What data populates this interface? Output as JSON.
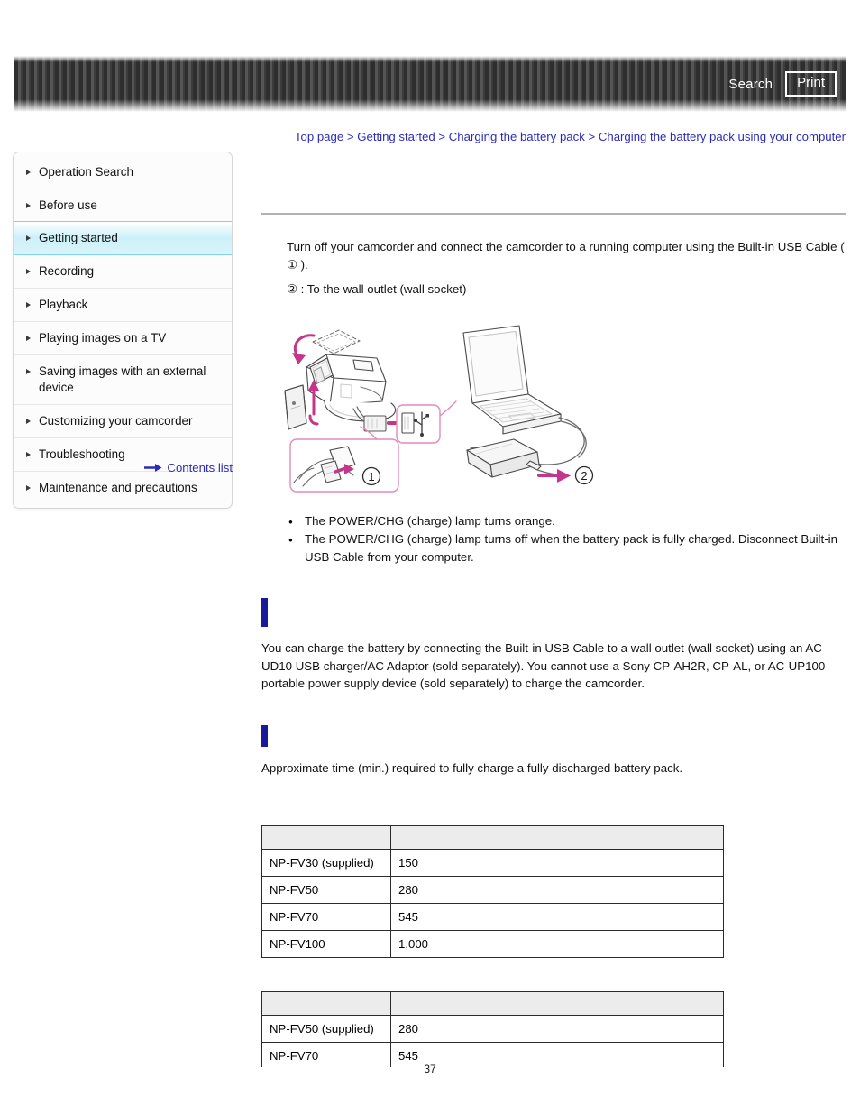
{
  "header": {
    "search_label": "Search",
    "print_label": "Print"
  },
  "breadcrumb": {
    "items": [
      "Top page",
      "Getting started",
      "Charging the battery pack",
      "Charging the battery pack using your computer"
    ],
    "separator": ">"
  },
  "sidebar": {
    "items": [
      {
        "label": "Operation Search",
        "active": false
      },
      {
        "label": "Before use",
        "active": false
      },
      {
        "label": "Getting started",
        "active": true
      },
      {
        "label": "Recording",
        "active": false
      },
      {
        "label": "Playback",
        "active": false
      },
      {
        "label": "Playing images on a TV",
        "active": false
      },
      {
        "label": "Saving images with an external device",
        "active": false
      },
      {
        "label": "Customizing your camcorder",
        "active": false
      },
      {
        "label": "Troubleshooting",
        "active": false
      },
      {
        "label": "Maintenance and precautions",
        "active": false
      }
    ],
    "contents_list_label": "Contents list"
  },
  "main": {
    "step_text_1": "Turn off your camcorder and connect the camcorder to a running computer using the Built-in USB Cable ( ① ).",
    "step_text_2": "② : To the wall outlet (wall socket)",
    "notes": [
      "The POWER/CHG (charge) lamp turns orange.",
      "The POWER/CHG (charge) lamp turns off when the battery pack is fully charged. Disconnect Built-in USB Cable from your computer."
    ],
    "figure_caption_1": "1",
    "figure_caption_2": "2",
    "sections": [
      {
        "heading": "",
        "body": "You can charge the battery by connecting the Built-in USB Cable to a wall outlet (wall socket) using an AC-UD10 USB charger/AC Adaptor (sold separately). You cannot use a Sony CP-AH2R, CP-AL, or AC-UP100 portable power supply device (sold separately) to charge the camcorder."
      },
      {
        "heading": "",
        "body": "Approximate time (min.) required to fully charge a fully discharged battery pack."
      }
    ]
  },
  "table_1": {
    "headers": [
      "",
      ""
    ],
    "rows": [
      [
        "NP-FV30 (supplied)",
        "150"
      ],
      [
        "NP-FV50",
        "280"
      ],
      [
        "NP-FV70",
        "545"
      ],
      [
        "NP-FV100",
        "1,000"
      ]
    ]
  },
  "table_2": {
    "headers": [
      "",
      ""
    ],
    "rows": [
      [
        "NP-FV50 (supplied)",
        "280"
      ],
      [
        "NP-FV70",
        "545"
      ]
    ]
  },
  "footer": {
    "page_number": "37"
  },
  "colors": {
    "link": "#2b2bbb",
    "section_marker": "#19199c",
    "active_nav": "#cdf0f8",
    "illustration_accent": "#c4368a",
    "header_dark": "#2e2e2e"
  }
}
